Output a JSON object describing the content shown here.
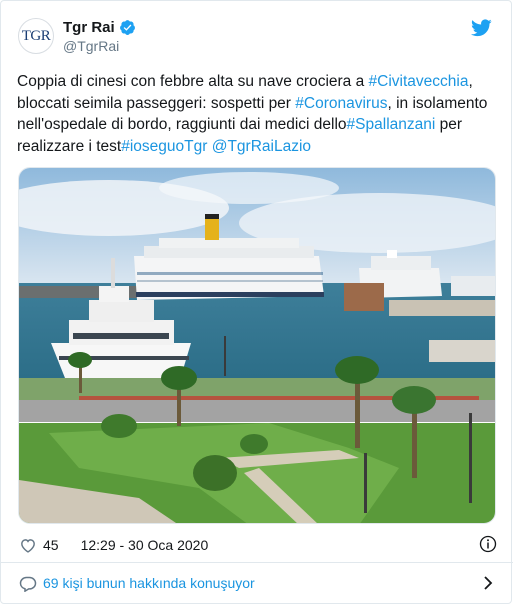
{
  "account": {
    "display_name": "Tgr Rai",
    "handle": "@TgrRai",
    "avatar_text": "TGR"
  },
  "tweet": {
    "segments": [
      {
        "text": "Coppia di cinesi con febbre alta su nave crociera a ",
        "link": false
      },
      {
        "text": "#Civitavecchia",
        "link": true
      },
      {
        "text": ", bloccati seimila passeggeri: sospetti per ",
        "link": false
      },
      {
        "text": "#Coronavirus",
        "link": true
      },
      {
        "text": ", in isolamento nell'ospedale di bordo, raggiunti dai medici dello",
        "link": false
      },
      {
        "text": "#Spallanzani",
        "link": true
      },
      {
        "text": " per realizzare i test",
        "link": false
      },
      {
        "text": "#ioseguoTgr",
        "link": true
      },
      {
        "text": " ",
        "link": false
      },
      {
        "text": "@TgrRaiLazio",
        "link": true
      }
    ]
  },
  "meta": {
    "likes": "45",
    "timestamp": "12:29 - 30 Oca 2020"
  },
  "conversation": {
    "label": "69 kişi bunun hakkında konuşuyor"
  },
  "colors": {
    "link": "#1b95e0",
    "text": "#14171a",
    "muted": "#657786",
    "border": "#e1e8ed"
  }
}
